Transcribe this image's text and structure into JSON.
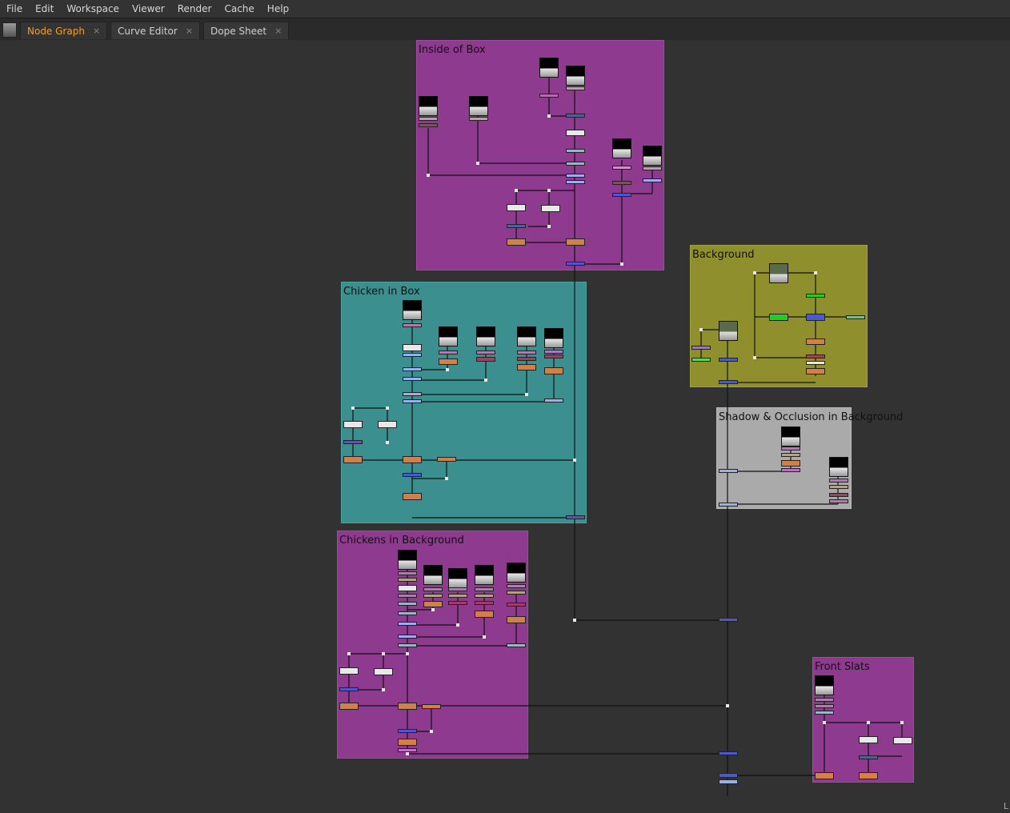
{
  "menu": [
    "File",
    "Edit",
    "Workspace",
    "Viewer",
    "Render",
    "Cache",
    "Help"
  ],
  "tabs": [
    {
      "label": "Node Graph",
      "active": true
    },
    {
      "label": "Curve Editor",
      "active": false
    },
    {
      "label": "Dope Sheet",
      "active": false
    }
  ],
  "tab_close_glyph": "×",
  "backdrops": {
    "inside_of_box": "Inside of Box",
    "chicken_in_box": "Chicken in Box",
    "chickens_in_background": "Chickens in Background",
    "background": "Background",
    "shadow_occlusion": "Shadow & Occlusion in Background",
    "front_slats": "Front Slats"
  },
  "colors": {
    "backdrop_purple": "#8e3a8e",
    "backdrop_teal": "#3b8f8f",
    "backdrop_olive": "#8f8f2e",
    "backdrop_grey": "#aaaaaa",
    "accent_tab": "#f0a030",
    "merge_blue": "#4a5ac8",
    "grade_orange": "#d08048"
  },
  "status": "L"
}
